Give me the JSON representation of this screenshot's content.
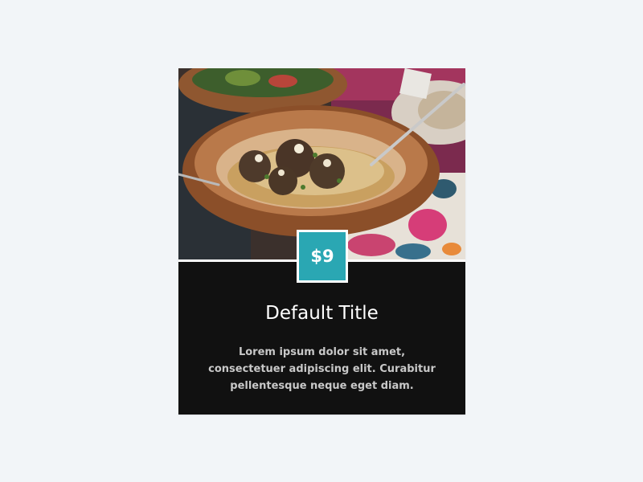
{
  "card": {
    "price": "$9",
    "title": "Default Title",
    "description": "Lorem ipsum dolor sit amet, consectetuer adipiscing elit. Curabitur pellentesque neque eget diam.",
    "image_icon": "food-photo-icon"
  },
  "colors": {
    "background": "#f2f5f8",
    "card_background": "#111111",
    "price_badge": "#2aa7b3",
    "title_text": "#ffffff",
    "description_text": "#c8c8c8"
  }
}
